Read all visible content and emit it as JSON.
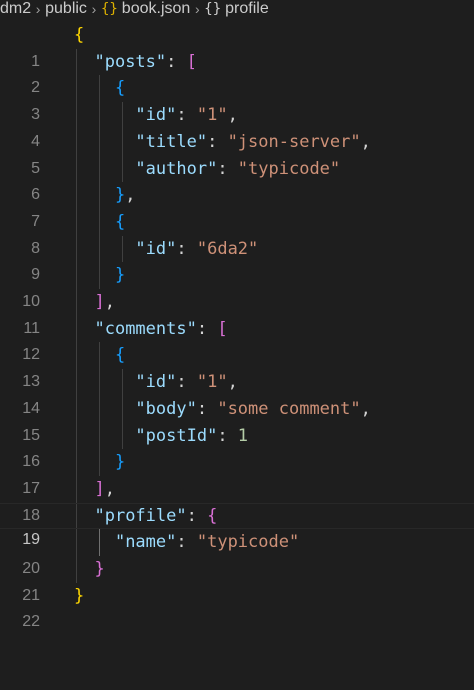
{
  "breadcrumb": {
    "items": [
      "dm2",
      "public",
      "book.json",
      "profile"
    ],
    "icons": [
      "json-file-icon",
      "json-object-icon"
    ]
  },
  "editor": {
    "current_line": 19,
    "lines": [
      {
        "n": "1"
      },
      {
        "n": "2"
      },
      {
        "n": "3"
      },
      {
        "n": "4"
      },
      {
        "n": "5"
      },
      {
        "n": "6"
      },
      {
        "n": "7"
      },
      {
        "n": "8"
      },
      {
        "n": "9"
      },
      {
        "n": "10"
      },
      {
        "n": "11"
      },
      {
        "n": "12"
      },
      {
        "n": "13"
      },
      {
        "n": "14"
      },
      {
        "n": "15"
      },
      {
        "n": "16"
      },
      {
        "n": "17"
      },
      {
        "n": "18"
      },
      {
        "n": "19"
      },
      {
        "n": "20"
      },
      {
        "n": "21"
      },
      {
        "n": "22"
      }
    ],
    "tokens": {
      "posts": "\"posts\"",
      "comments": "\"comments\"",
      "profile": "\"profile\"",
      "id": "\"id\"",
      "title": "\"title\"",
      "author": "\"author\"",
      "body": "\"body\"",
      "postId": "\"postId\"",
      "name": "\"name\"",
      "v_1": "\"1\"",
      "v_json_server": "\"json-server\"",
      "v_typicode": "\"typicode\"",
      "v_6da2": "\"6da2\"",
      "v_some_comment": "\"some comment\"",
      "v_postId": "1",
      "v_name": "\"typicode\""
    }
  },
  "colors": {
    "background": "#1e1e1e",
    "key": "#9cdcfe",
    "string": "#ce9178",
    "number": "#b5cea8",
    "bracket_level1": "#ffd700",
    "bracket_level2": "#da70d6",
    "bracket_level3": "#179fff"
  }
}
